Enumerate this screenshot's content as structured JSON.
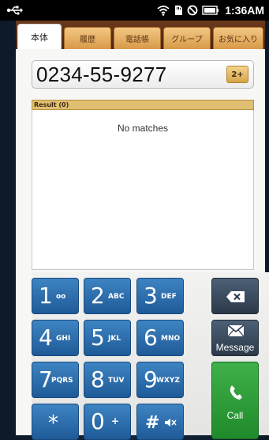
{
  "status_bar": {
    "time": "1:36AM",
    "icons": [
      "usb-icon",
      "wifi-icon",
      "sd-card-icon",
      "no-sim-icon",
      "battery-icon"
    ]
  },
  "tabs": [
    {
      "label": "本体",
      "active": true
    },
    {
      "label": "履歴",
      "active": false
    },
    {
      "label": "電話帳",
      "active": false
    },
    {
      "label": "グループ",
      "active": false
    },
    {
      "label": "お気に入り",
      "active": false
    }
  ],
  "dialer": {
    "number": "0234-55-9277",
    "add_contact_label": "2+"
  },
  "result": {
    "header": "Result (0)",
    "empty_text": "No matches"
  },
  "keypad": {
    "keys": [
      {
        "digit": "1",
        "letters": "oo"
      },
      {
        "digit": "2",
        "letters": "ABC"
      },
      {
        "digit": "3",
        "letters": "DEF"
      },
      {
        "digit": "4",
        "letters": "GHI"
      },
      {
        "digit": "5",
        "letters": "JKL"
      },
      {
        "digit": "6",
        "letters": "MNO"
      },
      {
        "digit": "7",
        "letters": "PQRS"
      },
      {
        "digit": "8",
        "letters": "TUV"
      },
      {
        "digit": "9",
        "letters": "WXYZ"
      },
      {
        "digit": "*",
        "letters": ""
      },
      {
        "digit": "0",
        "letters": "+"
      },
      {
        "digit": "#",
        "letters": ""
      }
    ],
    "message_label": "Message",
    "call_label": "Call"
  },
  "colors": {
    "key_blue": "#2a6aa8",
    "call_green": "#2a9a36",
    "tab_orange": "#e3ad5e",
    "result_header": "#e0bf72"
  }
}
